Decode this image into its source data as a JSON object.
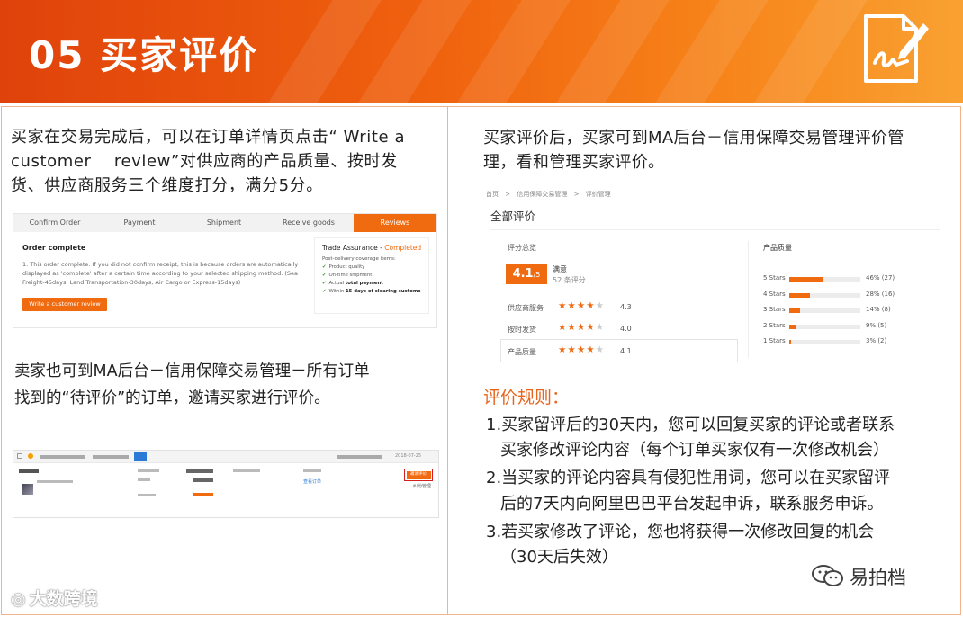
{
  "banner": {
    "title": "05 买家评价",
    "icon": "sign-document-icon"
  },
  "left": {
    "intro_lines": [
      "买家在交易完成后，可以在订单详情页点击“ Write a",
      "customer    revlew”对供应商的产品质量、按时发",
      "货、供应商服务三个维度打分，满分5分。"
    ],
    "order_panel": {
      "steps": [
        "Confirm Order",
        "Payment",
        "Shipment",
        "Receive goods",
        "Reviews"
      ],
      "heading": "Order complete",
      "body": "1. This order complete. If you did not confirm receipt, this is because orders are automatically displayed as 'complete' after a certain time according to your selected shipping method. (Sea Freight-45days, Land Transportation-30days, Air Cargo or Express-15days)",
      "button": "Write a customer review",
      "trade_assurance": "Trade Assurance - ",
      "trade_status": "Completed",
      "coverage_title": "Post-delivery coverage items:",
      "coverage_items": [
        "Product quality",
        "On-time shipment"
      ],
      "payment_prefix": "Actual ",
      "payment_bold": "total payment",
      "within_prefix": "Within ",
      "within_bold": "15 days of clearing customs"
    },
    "seller_lines": [
      "卖家也可到MA后台－信用保障交易管理－所有订单",
      "找到的“待评价”的订单，邀请买家进行评价。"
    ],
    "order_list": {
      "date": "2018-07-25",
      "action": "邀请评价",
      "link1": "查看订单",
      "link2": "纠纷管理"
    }
  },
  "right": {
    "intro_lines": [
      "买家评价后，买家可到MA后台－信用保障交易管理评价管",
      "理，看和管理买家评价。"
    ],
    "review_panel": {
      "breadcrumb": [
        "首页",
        "信用保障交易管理",
        "评价管理"
      ],
      "title": "全部评价",
      "overview_label": "评分总览",
      "score": "4.1",
      "score_max": "/5",
      "satisfaction": "满意",
      "count": "52 条评分",
      "dimensions": [
        {
          "label": "供应商服务",
          "value": "4.3"
        },
        {
          "label": "按时发货",
          "value": "4.0"
        },
        {
          "label": "产品质量",
          "value": "4.1"
        }
      ],
      "quality_label": "产品质量",
      "distribution": [
        {
          "label": "5 Stars",
          "text": "46% (27)",
          "pct": 46
        },
        {
          "label": "4 Stars",
          "text": "28% (16)",
          "pct": 28
        },
        {
          "label": "3 Stars",
          "text": "14% (8)",
          "pct": 14
        },
        {
          "label": "2 Stars",
          "text": "9% (5)",
          "pct": 9
        },
        {
          "label": "1 Stars",
          "text": "3% (2)",
          "pct": 3
        }
      ]
    },
    "rules_title": "评价规则：",
    "rules": [
      "1.买家留评后的30天内，您可以回复买家的评论或者联系",
      "买家修改评论内容（每个订单买家仅有一次修改机会）",
      "2.当买家的评论内容具有侵犯性用词，您可以在买家留评",
      "后的7天内向阿里巴巴平台发起申诉，联系服务申诉。",
      "3.若买家修改了评论，您也将获得一次修改回复的机会",
      "（30天后失效）"
    ]
  },
  "watermarks": {
    "right": "易拍档",
    "left": "大数跨境"
  },
  "colors": {
    "accent": "#f06a10",
    "banner_start": "#e0420b",
    "banner_end": "#f9a132",
    "rule_title": "#e8651d",
    "highlight_border": "#d21f1f"
  }
}
